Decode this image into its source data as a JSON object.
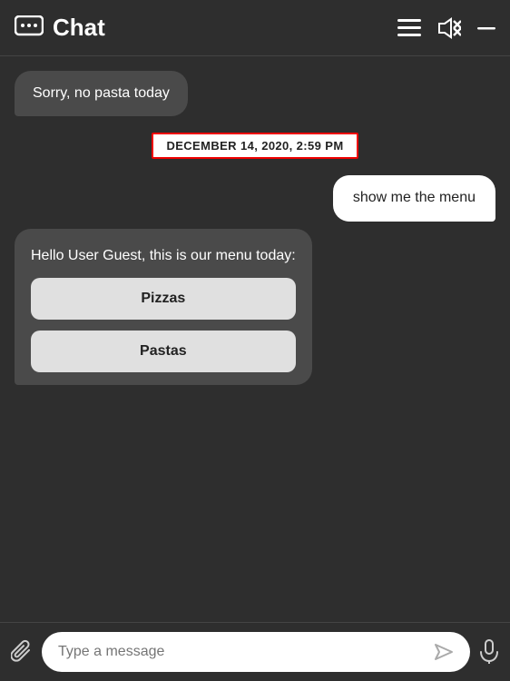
{
  "header": {
    "title": "Chat",
    "icons": {
      "menu": "≡",
      "mute": "🔇",
      "minimize": "—"
    }
  },
  "messages": [
    {
      "type": "received",
      "text": "Sorry, no pasta today"
    },
    {
      "type": "date-separator",
      "text": "DECEMBER 14, 2020, 2:59 PM"
    },
    {
      "type": "sent",
      "text": "show me the menu"
    },
    {
      "type": "bot-card",
      "text": "Hello User Guest, this is our menu today:",
      "buttons": [
        "Pizzas",
        "Pastas"
      ]
    }
  ],
  "input": {
    "placeholder": "Type a message"
  }
}
